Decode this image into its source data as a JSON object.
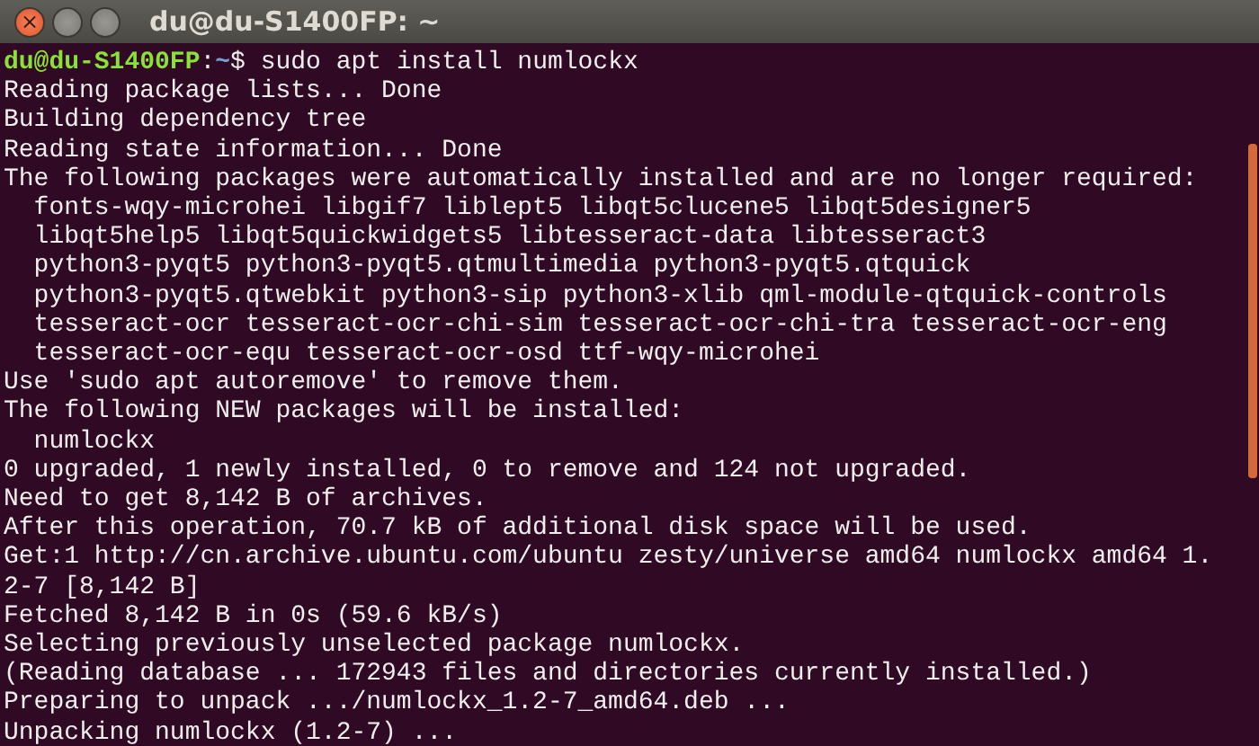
{
  "window": {
    "title": "du@du-S1400FP: ~",
    "controls": [
      {
        "kind": "close",
        "label": "×"
      },
      {
        "kind": "minimize"
      },
      {
        "kind": "maximize"
      }
    ]
  },
  "terminal": {
    "lines": [
      {
        "kind": "prompt",
        "user_host": "du@du-S1400FP",
        "separator": ":",
        "path": "~",
        "symbol": "$",
        "command": "sudo apt install numlockx"
      },
      {
        "kind": "output",
        "text": "Reading package lists... Done"
      },
      {
        "kind": "output",
        "text": "Building dependency tree"
      },
      {
        "kind": "output",
        "text": "Reading state information... Done"
      },
      {
        "kind": "output",
        "text": "The following packages were automatically installed and are no longer required:"
      },
      {
        "kind": "output",
        "text": "  fonts-wqy-microhei libgif7 liblept5 libqt5clucene5 libqt5designer5"
      },
      {
        "kind": "output",
        "text": "  libqt5help5 libqt5quickwidgets5 libtesseract-data libtesseract3"
      },
      {
        "kind": "output",
        "text": "  python3-pyqt5 python3-pyqt5.qtmultimedia python3-pyqt5.qtquick"
      },
      {
        "kind": "output",
        "text": "  python3-pyqt5.qtwebkit python3-sip python3-xlib qml-module-qtquick-controls"
      },
      {
        "kind": "output",
        "text": "  tesseract-ocr tesseract-ocr-chi-sim tesseract-ocr-chi-tra tesseract-ocr-eng"
      },
      {
        "kind": "output",
        "text": "  tesseract-ocr-equ tesseract-ocr-osd ttf-wqy-microhei"
      },
      {
        "kind": "output",
        "text": "Use 'sudo apt autoremove' to remove them."
      },
      {
        "kind": "output",
        "text": "The following NEW packages will be installed:"
      },
      {
        "kind": "output",
        "text": "  numlockx"
      },
      {
        "kind": "output",
        "text": "0 upgraded, 1 newly installed, 0 to remove and 124 not upgraded."
      },
      {
        "kind": "output",
        "text": "Need to get 8,142 B of archives."
      },
      {
        "kind": "output",
        "text": "After this operation, 70.7 kB of additional disk space will be used."
      },
      {
        "kind": "output",
        "text": "Get:1 http://cn.archive.ubuntu.com/ubuntu zesty/universe amd64 numlockx amd64 1."
      },
      {
        "kind": "output",
        "text": "2-7 [8,142 B]"
      },
      {
        "kind": "output",
        "text": "Fetched 8,142 B in 0s (59.6 kB/s)"
      },
      {
        "kind": "output",
        "text": "Selecting previously unselected package numlockx."
      },
      {
        "kind": "output",
        "text": "(Reading database ... 172943 files and directories currently installed.)"
      },
      {
        "kind": "output",
        "text": "Preparing to unpack .../numlockx_1.2-7_amd64.deb ..."
      },
      {
        "kind": "output",
        "text": "Unpacking numlockx (1.2-7) ..."
      }
    ]
  }
}
